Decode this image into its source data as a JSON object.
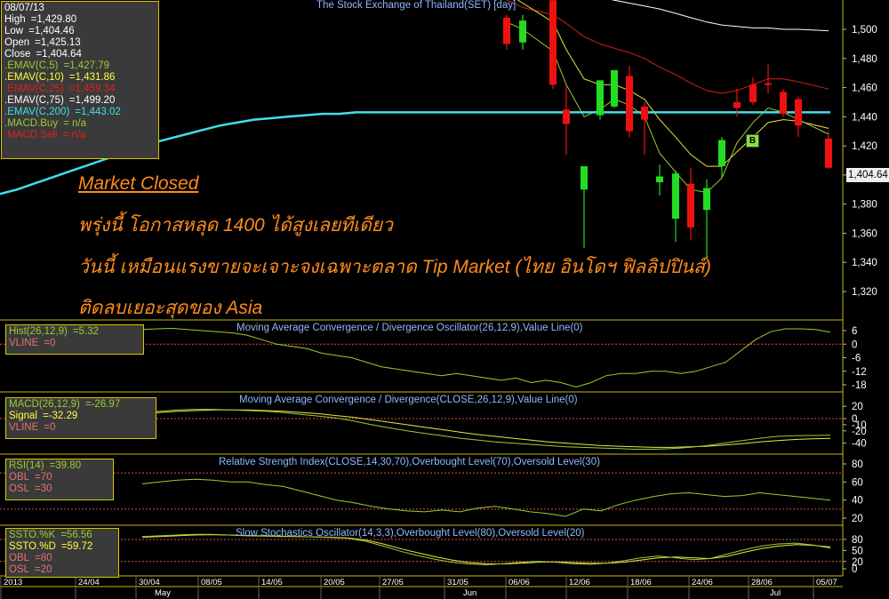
{
  "price_panel": {
    "title": "The Stock Exchange of Thailand(SET) [day]",
    "last_price": "1,404.64",
    "axis_labels": [
      "1,500",
      "1,480",
      "1,460",
      "1,440",
      "1,420",
      "1,400",
      "1,380",
      "1,360",
      "1,340",
      "1,320"
    ]
  },
  "ohlc_legend": [
    {
      "k": "08/07/13",
      "v": "",
      "color": "#ffffff"
    },
    {
      "k": "High",
      "v": "=1,429.80",
      "color": "#ffffff"
    },
    {
      "k": "Low",
      "v": "=1,404.46",
      "color": "#ffffff"
    },
    {
      "k": "Open",
      "v": "=1,425.13",
      "color": "#ffffff"
    },
    {
      "k": "Close",
      "v": "=1,404.64",
      "color": "#ffffff"
    },
    {
      "k": ".EMAV(C,5)",
      "v": "=1,427.79",
      "color": "#9acd32"
    },
    {
      "k": ".EMAV(C,10)",
      "v": "=1,431.86",
      "color": "#ffff40"
    },
    {
      "k": ".EMAV(C,25)",
      "v": "=1,459.34",
      "color": "#e02020"
    },
    {
      "k": ".EMAV(C,75)",
      "v": "=1,499.20",
      "color": "#ffffff"
    },
    {
      "k": ".EMAV(C,200)",
      "v": "=1,443.02",
      "color": "#40e0e8"
    },
    {
      "k": ".MACD.Buy",
      "v": "= n/a",
      "color": "#9acd32"
    },
    {
      "k": ".MACD.Sell",
      "v": "= n/a",
      "color": "#e02020"
    }
  ],
  "annotation": {
    "heading": "Market Closed",
    "line1": "พรุ่งนี้ โอกาสหลุด 1400 ได้สูงเลยทีเดียว",
    "line2": "วันนี้ เหมือนแรงขายจะเจาะจงเฉพาะตลาด Tip Market (ไทย อินโดฯ ฟิลลิปปินส์)",
    "line3": "ติดลบเยอะสุดของ Asia"
  },
  "signal_badge": "B",
  "hist_panel": {
    "title": "Moving Average Convergence / Divergence Oscillator(26,12,9),Value Line(0)",
    "legend": [
      {
        "k": "Hist(26,12,9)",
        "v": "=5.32",
        "color": "#9acd32"
      },
      {
        "k": "VLINE",
        "v": "=0",
        "color": "#e87070"
      }
    ],
    "axis_labels": [
      "6",
      "0",
      "-6",
      "-12",
      "-18"
    ]
  },
  "macd_panel": {
    "title": "Moving Average Convergence / Divergence(CLOSE,26,12,9),Value Line(0)",
    "legend": [
      {
        "k": "MACD(26,12,9)",
        "v": "=-26.97",
        "color": "#9acd32"
      },
      {
        "k": "Signal",
        "v": "=-32.29",
        "color": "#ffff40"
      },
      {
        "k": "VLINE",
        "v": "=0",
        "color": "#e87070"
      }
    ],
    "axis_labels": [
      "20",
      "0",
      "-10",
      "-20",
      "-40"
    ]
  },
  "rsi_panel": {
    "title": "Relative Strength Index(CLOSE,14,30,70),Overbought Level(70),Oversold Level(30)",
    "legend": [
      {
        "k": "RSI(14)",
        "v": "=39.80",
        "color": "#9acd32"
      },
      {
        "k": "OBL",
        "v": "=70",
        "color": "#e87070"
      },
      {
        "k": "OSL",
        "v": "=30",
        "color": "#e87070"
      }
    ],
    "axis_labels": [
      "80",
      "60",
      "40",
      "20"
    ]
  },
  "ssto_panel": {
    "title": "Slow Stochastics Oscillator(14,3,3),Overbought Level(80),Oversold Level(20)",
    "legend": [
      {
        "k": "SSTO.%K",
        "v": "=56.56",
        "color": "#9acd32"
      },
      {
        "k": "SSTO.%D",
        "v": "=59.72",
        "color": "#ffff40"
      },
      {
        "k": "OBL",
        "v": "=80",
        "color": "#e87070"
      },
      {
        "k": "OSL",
        "v": "=20",
        "color": "#e87070"
      }
    ],
    "axis_labels": [
      "80",
      "50",
      "20",
      "0"
    ]
  },
  "date_axis": {
    "dates": [
      "2013",
      "24/04",
      "30/04",
      "08/05",
      "14/05",
      "20/05",
      "27/05",
      "31/05",
      "06/06",
      "12/06",
      "18/06",
      "24/06",
      "28/06",
      "05/07"
    ],
    "months": [
      "May",
      "Jun",
      "Jul"
    ]
  },
  "colors": {
    "bull": "#22dd22",
    "bear": "#ee1111",
    "ema5": "#9acd32",
    "ema10": "#e8e840",
    "ema25": "#d42020",
    "ema75": "#ffffff",
    "ema200": "#40e0e8",
    "level": "#e05050",
    "legend_border": "#d8c800",
    "title": "#8fb7ff",
    "annotation": "#ff8c1a"
  },
  "chart_data": [
    {
      "type": "candlestick",
      "title": "The Stock Exchange of Thailand(SET) [day]",
      "ylim": [
        1310,
        1510
      ],
      "candles": [
        {
          "o": 1508,
          "h": 1510,
          "l": 1486,
          "c": 1490
        },
        {
          "o": 1491,
          "h": 1510,
          "l": 1486,
          "c": 1506
        },
        {
          "o": 1520,
          "h": 1524,
          "l": 1459,
          "c": 1462
        },
        {
          "o": 1445,
          "h": 1462,
          "l": 1414,
          "c": 1435
        },
        {
          "o": 1390,
          "h": 1398,
          "l": 1350,
          "c": 1406
        },
        {
          "o": 1441,
          "h": 1463,
          "l": 1438,
          "c": 1465
        },
        {
          "o": 1447,
          "h": 1470,
          "l": 1446,
          "c": 1472
        },
        {
          "o": 1468,
          "h": 1475,
          "l": 1426,
          "c": 1430
        },
        {
          "o": 1447,
          "h": 1450,
          "l": 1414,
          "c": 1438
        },
        {
          "o": 1395,
          "h": 1407,
          "l": 1386,
          "c": 1399
        },
        {
          "o": 1370,
          "h": 1403,
          "l": 1354,
          "c": 1401
        },
        {
          "o": 1394,
          "h": 1405,
          "l": 1355,
          "c": 1364
        },
        {
          "o": 1376,
          "h": 1397,
          "l": 1342,
          "c": 1391
        },
        {
          "o": 1406,
          "h": 1426,
          "l": 1398,
          "c": 1424
        },
        {
          "o": 1450,
          "h": 1459,
          "l": 1440,
          "c": 1446
        },
        {
          "o": 1462,
          "h": 1467,
          "l": 1448,
          "c": 1450
        },
        {
          "o": 1463,
          "h": 1476,
          "l": 1456,
          "c": 1462
        },
        {
          "o": 1457,
          "h": 1459,
          "l": 1440,
          "c": 1442
        },
        {
          "o": 1452,
          "h": 1454,
          "l": 1426,
          "c": 1434
        },
        {
          "o": 1425,
          "h": 1430,
          "l": 1404,
          "c": 1405
        }
      ],
      "ema5": [
        1505,
        1500,
        1485,
        1462,
        1440,
        1445,
        1452,
        1448,
        1440,
        1415,
        1402,
        1390,
        1388,
        1398,
        1422,
        1436,
        1446,
        1443,
        1438,
        1428
      ],
      "ema10": [
        1525,
        1518,
        1505,
        1486,
        1466,
        1462,
        1462,
        1458,
        1452,
        1438,
        1426,
        1414,
        1406,
        1406,
        1416,
        1426,
        1436,
        1438,
        1437,
        1432
      ],
      "ema25": [
        1520,
        1515,
        1510,
        1504,
        1495,
        1490,
        1487,
        1484,
        1480,
        1474,
        1469,
        1463,
        1458,
        1456,
        1458,
        1462,
        1466,
        1466,
        1464,
        1459
      ],
      "ema75": [
        1528,
        1528,
        1527,
        1526,
        1524,
        1522,
        1520,
        1518,
        1516,
        1514,
        1511,
        1508,
        1505,
        1503,
        1502,
        1501,
        1501,
        1500,
        1500,
        1499
      ],
      "ema200_full": [
        1387,
        1390,
        1394,
        1398,
        1402,
        1406,
        1410,
        1414,
        1418,
        1422,
        1425,
        1428,
        1431,
        1434,
        1436,
        1438,
        1439,
        1440,
        1441,
        1442,
        1442,
        1443,
        1443,
        1443,
        1443,
        1443,
        1443,
        1443,
        1443,
        1443,
        1443,
        1443,
        1443,
        1443,
        1443,
        1443,
        1443,
        1443,
        1443,
        1443,
        1443,
        1443,
        1443,
        1443,
        1443,
        1443,
        1443,
        1443,
        1443,
        1443
      ]
    },
    {
      "type": "line",
      "name": "Hist(26,12,9)",
      "values": [
        6.5,
        6.8,
        7,
        6.5,
        6,
        5.5,
        5,
        4,
        2,
        0,
        -1,
        -2,
        -4,
        -5,
        -6,
        -8,
        -10,
        -11,
        -12,
        -13,
        -14,
        -13,
        -14,
        -15,
        -16,
        -15,
        -17,
        -16,
        -17,
        -19,
        -17,
        -14,
        -13,
        -13,
        -12,
        -12,
        -13,
        -12,
        -10,
        -8,
        -3,
        2,
        5.5,
        6.8,
        6.8,
        6.5,
        5.32
      ]
    },
    {
      "type": "line",
      "name": "MACD(26,12,9)",
      "values": [
        10,
        12,
        14,
        15,
        15,
        14,
        13,
        12,
        10,
        7,
        4,
        1,
        -4,
        -10,
        -15,
        -20,
        -24,
        -28,
        -32,
        -35,
        -38,
        -40,
        -42,
        -44,
        -46,
        -47,
        -48,
        -49,
        -50,
        -50,
        -49,
        -47,
        -44,
        -40,
        -36,
        -32,
        -29,
        -28,
        -27.5,
        -26.97
      ]
    },
    {
      "type": "line",
      "name": "Signal",
      "values": [
        8,
        10,
        12,
        13,
        14,
        14,
        14,
        13,
        12,
        10,
        8,
        5,
        2,
        -2,
        -6,
        -10,
        -14,
        -18,
        -22,
        -26,
        -29,
        -32,
        -35,
        -38,
        -40,
        -42,
        -44,
        -45,
        -46,
        -47,
        -47,
        -46,
        -45,
        -43,
        -41,
        -38,
        -36,
        -34,
        -33,
        -32.29
      ]
    },
    {
      "type": "line",
      "name": "RSI(14)",
      "values": [
        58,
        60,
        62,
        63,
        62,
        60,
        60,
        57,
        55,
        50,
        45,
        40,
        37,
        33,
        30,
        28,
        27,
        29,
        27,
        31,
        33,
        30,
        27,
        25,
        22,
        30,
        28,
        35,
        40,
        44,
        47,
        48,
        46,
        44,
        45,
        48,
        46,
        44,
        42,
        39.8
      ]
    },
    {
      "type": "line",
      "name": "SSTO.%K",
      "values": [
        88,
        90,
        92,
        94,
        94,
        92,
        90,
        89,
        88,
        88,
        87,
        85,
        83,
        75,
        62,
        48,
        36,
        26,
        18,
        13,
        11,
        14,
        18,
        20,
        18,
        14,
        12,
        15,
        22,
        30,
        35,
        30,
        25,
        28,
        40,
        52,
        62,
        68,
        70,
        65,
        56.56
      ]
    },
    {
      "type": "line",
      "name": "SSTO.%D",
      "values": [
        86,
        88,
        90,
        92,
        93,
        92,
        91,
        90,
        89,
        88,
        87,
        86,
        84,
        78,
        68,
        55,
        44,
        33,
        24,
        17,
        14,
        13,
        15,
        18,
        19,
        17,
        15,
        15,
        18,
        24,
        30,
        32,
        30,
        28,
        34,
        45,
        55,
        62,
        66,
        64,
        59.72
      ]
    }
  ]
}
